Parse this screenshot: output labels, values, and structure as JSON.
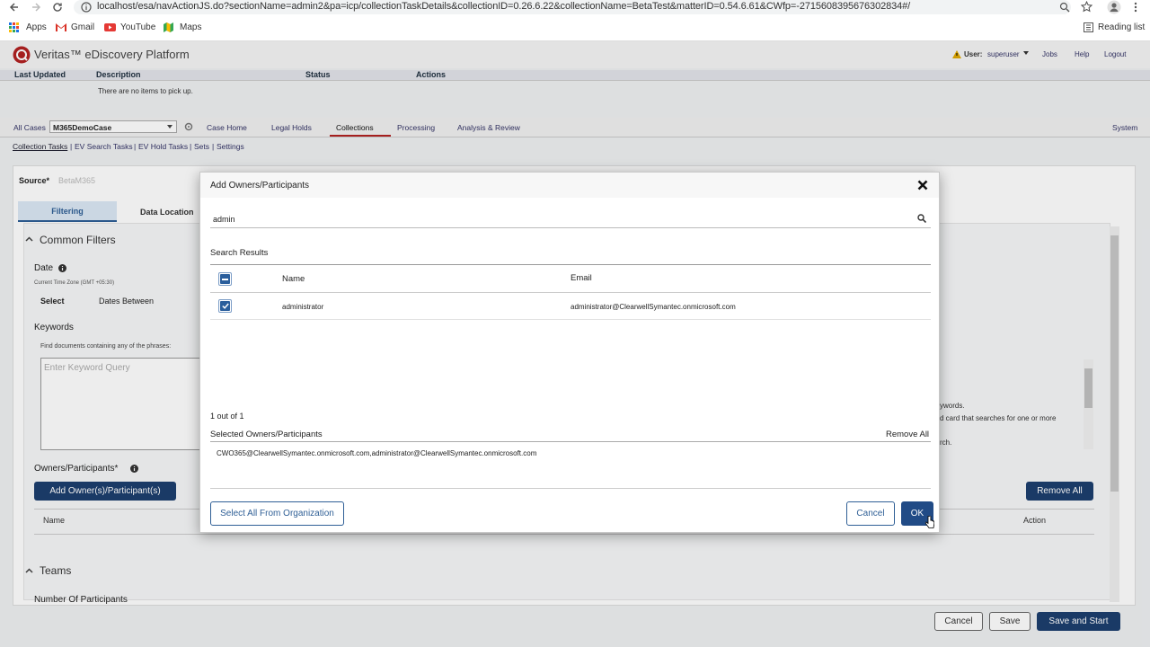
{
  "browser": {
    "url": "localhost/esa/navActionJS.do?sectionName=admin2&pa=icp/collectionTaskDetails&collectionID=0.26.6.22&collectionName=BetaTest&matterID=0.54.6.61&CWfp=-2715608395676302834#/",
    "bookmarks": [
      "Apps",
      "Gmail",
      "YouTube",
      "Maps"
    ],
    "reading_list": "Reading list"
  },
  "header": {
    "brand": "Veritas™ eDiscovery Platform",
    "user_label": "User:",
    "user_name": "superuser",
    "links": [
      "Jobs",
      "Help",
      "Logout"
    ]
  },
  "jobs_table": {
    "columns": [
      "Last Updated",
      "Description",
      "Status",
      "Actions"
    ],
    "empty_text": "There are no items to pick up."
  },
  "nav": {
    "all_cases": "All Cases",
    "case_select": "M365DemoCase",
    "tabs": [
      "Case Home",
      "Legal Holds",
      "Collections",
      "Processing",
      "Analysis & Review"
    ],
    "active_tab": "Collections",
    "system": "System",
    "subtabs": [
      "Collection Tasks",
      "EV Search Tasks",
      "EV Hold Tasks",
      "Sets",
      "Settings"
    ]
  },
  "page": {
    "source_label": "Source*",
    "source_value": "BetaM365",
    "tabs": [
      "Filtering",
      "Data Location"
    ],
    "common_filters": "Common Filters",
    "date_label": "Date",
    "timezone": "Current Time Zone (GMT +05:30)",
    "select_label": "Select",
    "select_value": "Dates Between",
    "keywords_label": "Keywords",
    "keywords_hint": "Find documents containing any of the phrases:",
    "keyword_placeholder": "Enter Keyword Query",
    "help_text_1": "ywords.",
    "help_text_2": "d card that searches for one or more",
    "help_text_3": "rch.",
    "owners_label": "Owners/Participants*",
    "add_owner_button": "Add Owner(s)/Participant(s)",
    "remove_all_button": "Remove All",
    "col_name": "Name",
    "col_action": "Action",
    "teams": "Teams",
    "num_participants": "Number Of Participants",
    "footer_cancel": "Cancel",
    "footer_save": "Save",
    "footer_save_start": "Save and Start"
  },
  "dialog": {
    "title": "Add Owners/Participants",
    "search_value": "admin",
    "search_results_label": "Search Results",
    "col_name": "Name",
    "col_email": "Email",
    "rows": [
      {
        "name": "administrator",
        "email": "administrator@ClearwellSymantec.onmicrosoft.com",
        "checked": true
      }
    ],
    "count_text": "1 out of 1",
    "selected_label": "Selected Owners/Participants",
    "remove_all": "Remove All",
    "selected_value": "CWO365@ClearwellSymantec.onmicrosoft.com,administrator@ClearwellSymantec.onmicrosoft.com",
    "select_all_button": "Select All From Organization",
    "cancel_button": "Cancel",
    "ok_button": "OK"
  },
  "colors": {
    "brand_red": "#b22222",
    "primary_dark": "#1d3f6e",
    "link_blue": "#2f5f96",
    "tab_active_bg": "#dbe8f5"
  }
}
